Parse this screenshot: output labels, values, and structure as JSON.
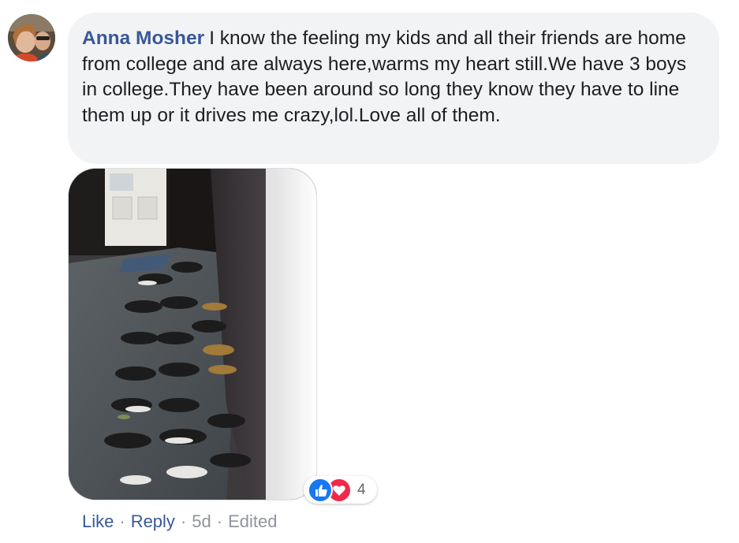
{
  "comment": {
    "author": "Anna Mosher",
    "text": "I know the feeling my kids and all their friends are home from college and are always here,warms my heart still.We have 3 boys in college.They have been around so long they know they have to line them up or it drives me crazy,lol.Love all of them."
  },
  "reactions": {
    "icons": [
      "like-icon",
      "love-icon"
    ],
    "count": "4"
  },
  "actions": {
    "like": "Like",
    "reply": "Reply",
    "time": "5d",
    "edited": "Edited",
    "separator": "·"
  },
  "colors": {
    "author_link": "#385898",
    "bubble_bg": "#f2f3f5",
    "like_blue": "#1877f2",
    "love_red": "#f0284a",
    "meta_gray": "#90949c"
  }
}
